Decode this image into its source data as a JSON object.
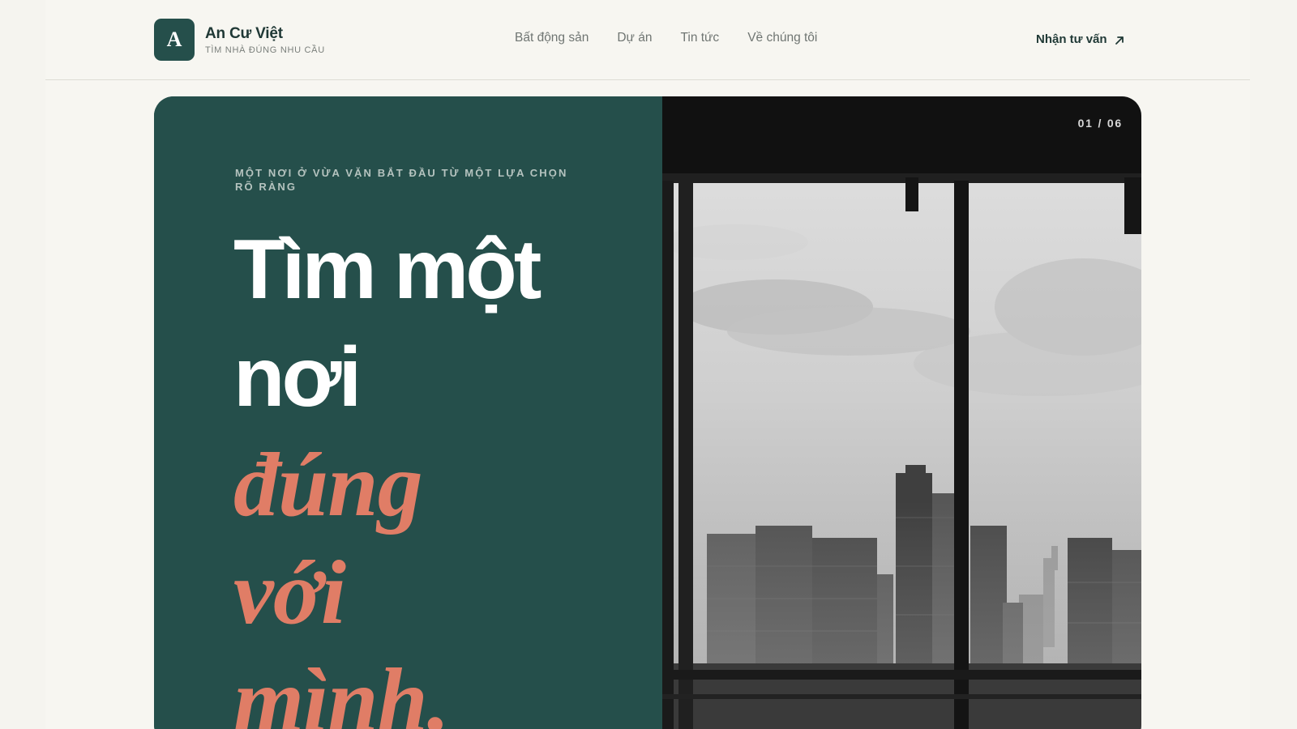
{
  "brand": {
    "logo_letter": "A",
    "name": "An Cư Việt",
    "tagline": "TÌM NHÀ ĐÚNG NHU CẦU"
  },
  "nav": {
    "items": [
      {
        "label": "Bất động sản"
      },
      {
        "label": "Dự án"
      },
      {
        "label": "Tin tức"
      },
      {
        "label": "Về chúng tôi"
      }
    ],
    "cta_label": "Nhận tư vấn",
    "cta_icon": "arrow-up-right-icon"
  },
  "hero": {
    "eyebrow": "MỘT NƠI Ở VỪA VẶN BẮT ĐẦU TỪ MỘT LỰA CHỌN RÕ RÀNG",
    "headline_lines": [
      "Tìm một",
      "nơi"
    ],
    "accent_lines": [
      "đúng",
      "với",
      "mình."
    ],
    "slide_counter": "01 / 06",
    "image_description_icon": "city-window-photo"
  },
  "colors": {
    "page_bg": "#f7f6f1",
    "brand_green": "#254f4b",
    "accent_coral": "#e07d66",
    "text_dark": "#1f3835",
    "text_muted": "#6f7572"
  }
}
